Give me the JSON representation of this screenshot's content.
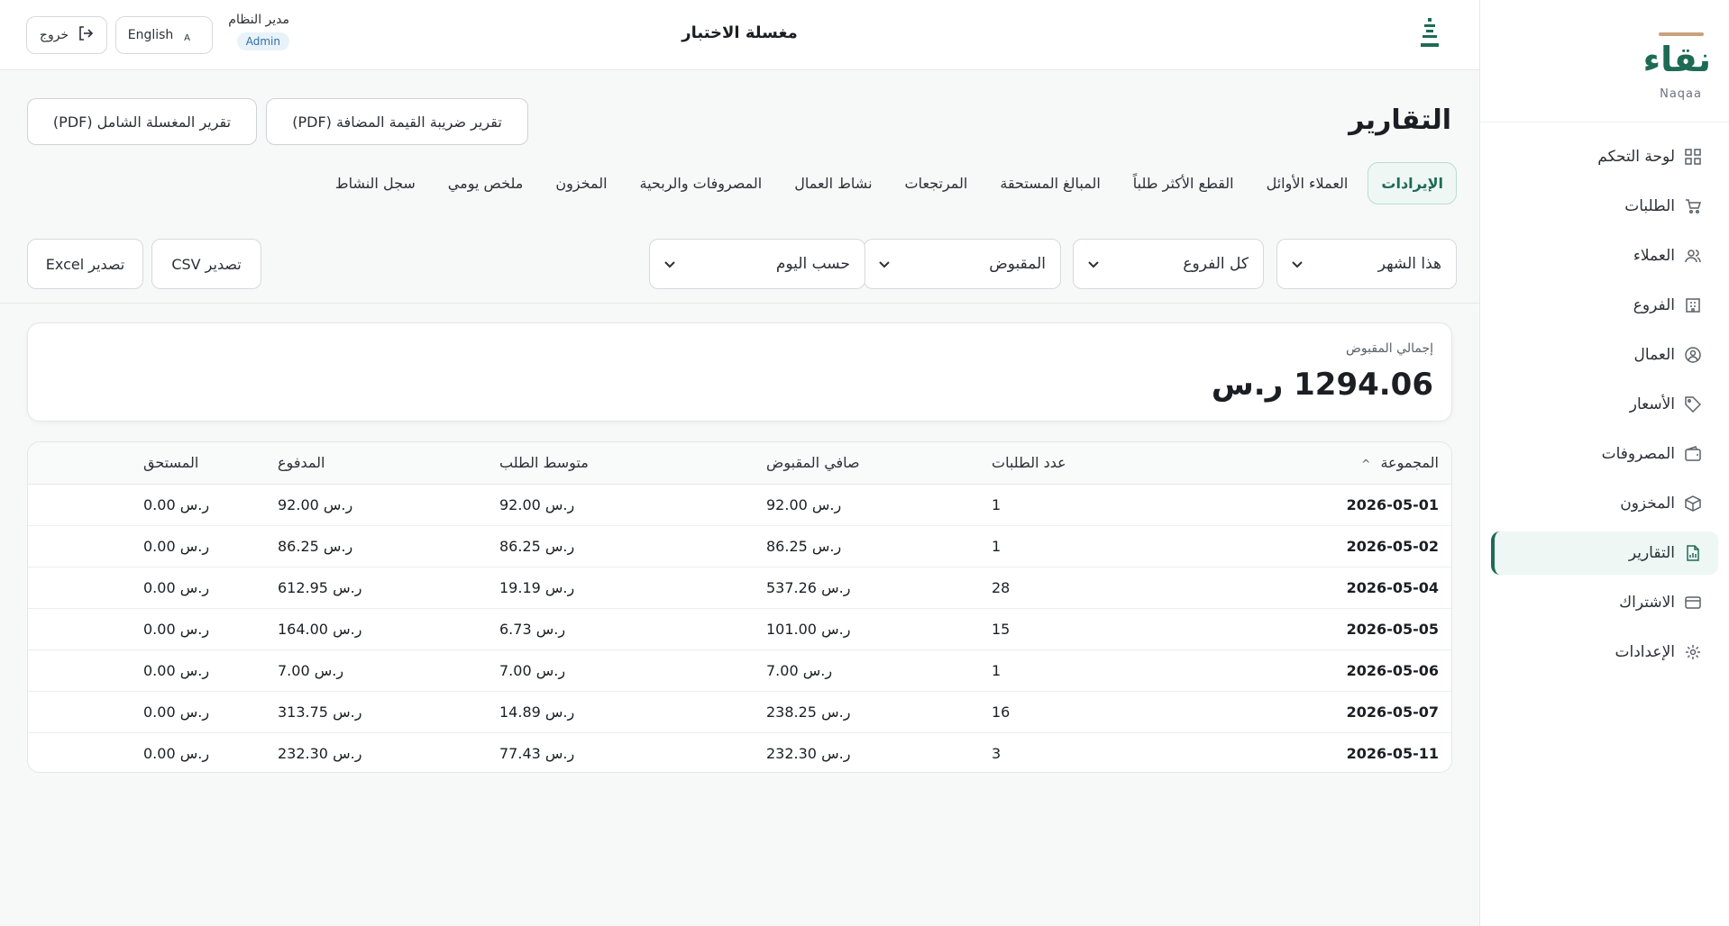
{
  "sidebar": {
    "brand_name": "نقاء",
    "brand_sub": "Naqaa",
    "items": [
      {
        "label": "لوحة التحكم",
        "icon": "grid-icon"
      },
      {
        "label": "الطلبات",
        "icon": "cart-icon"
      },
      {
        "label": "العملاء",
        "icon": "users-icon"
      },
      {
        "label": "الفروع",
        "icon": "building-icon"
      },
      {
        "label": "العمال",
        "icon": "user-circle-icon"
      },
      {
        "label": "الأسعار",
        "icon": "tag-icon"
      },
      {
        "label": "المصروفات",
        "icon": "wallet-icon"
      },
      {
        "label": "المخزون",
        "icon": "box-icon"
      },
      {
        "label": "التقارير",
        "icon": "report-icon",
        "active": true
      },
      {
        "label": "الاشتراك",
        "icon": "card-icon"
      },
      {
        "label": "الإعدادات",
        "icon": "gear-icon"
      }
    ]
  },
  "header": {
    "title": "مغسلة الاختبار",
    "user_name": "مدير النظام",
    "user_role": "Admin",
    "lang_label": "English",
    "logout_label": "خروج"
  },
  "page": {
    "title": "التقارير",
    "pdf_vat_label": "تقرير ضريبة القيمة المضافة (PDF)",
    "pdf_full_label": "تقرير المغسلة الشامل (PDF)"
  },
  "tabs": [
    "الإيرادات",
    "العملاء الأوائل",
    "القطع الأكثر طلباً",
    "المبالغ المستحقة",
    "المرتجعات",
    "نشاط العمال",
    "المصروفات والربحية",
    "المخزون",
    "ملخص يومي",
    "سجل النشاط"
  ],
  "filters": {
    "period": "هذا الشهر",
    "branch": "كل الفروع",
    "measure": "المقبوض",
    "group_by": "حسب اليوم"
  },
  "export": {
    "csv_label": "تصدير CSV",
    "excel_label": "تصدير Excel"
  },
  "summary": {
    "label": "إجمالي المقبوض",
    "value": "1294.06 ر.س"
  },
  "table": {
    "headers": [
      "المجموعة",
      "عدد الطلبات",
      "صافي المقبوض",
      "متوسط الطلب",
      "المدفوع",
      "المستحق"
    ],
    "rows": [
      [
        "2026-05-01",
        "1",
        "ر.س 92.00",
        "ر.س 92.00",
        "ر.س 92.00",
        "ر.س 0.00"
      ],
      [
        "2026-05-02",
        "1",
        "ر.س 86.25",
        "ر.س 86.25",
        "ر.س 86.25",
        "ر.س 0.00"
      ],
      [
        "2026-05-04",
        "28",
        "ر.س 537.26",
        "ر.س 19.19",
        "ر.س 612.95",
        "ر.س 0.00"
      ],
      [
        "2026-05-05",
        "15",
        "ر.س 101.00",
        "ر.س 6.73",
        "ر.س 164.00",
        "ر.س 0.00"
      ],
      [
        "2026-05-06",
        "1",
        "ر.س 7.00",
        "ر.س 7.00",
        "ر.س 7.00",
        "ر.س 0.00"
      ],
      [
        "2026-05-07",
        "16",
        "ر.س 238.25",
        "ر.س 14.89",
        "ر.س 313.75",
        "ر.س 0.00"
      ],
      [
        "2026-05-11",
        "3",
        "ر.س 232.30",
        "ر.س 77.43",
        "ر.س 232.30",
        "ر.س 0.00"
      ]
    ]
  },
  "colors": {
    "brand": "#1e6b55",
    "accent_gold": "#c9a27b",
    "active_bg": "#eef7f4"
  }
}
